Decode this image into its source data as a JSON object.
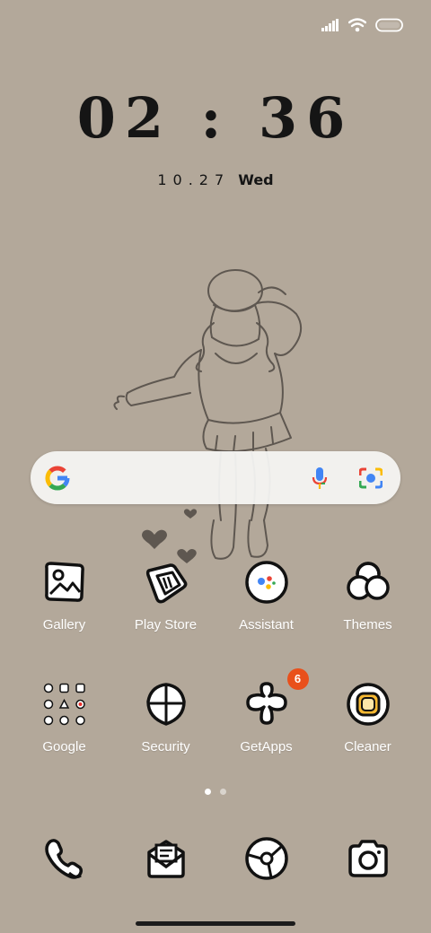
{
  "status_bar": {
    "icons": [
      "signal-icon",
      "wifi-icon",
      "battery-icon"
    ]
  },
  "lockscreen_clock": {
    "time": "02 : 36",
    "date_digits": "10.27",
    "weekday": "Wed"
  },
  "search_bar": {
    "icons": [
      "google-g-icon",
      "microphone-icon",
      "google-lens-icon"
    ]
  },
  "apps_row1": [
    {
      "label": "Gallery",
      "icon": "gallery-icon"
    },
    {
      "label": "Play Store",
      "icon": "play-store-icon"
    },
    {
      "label": "Assistant",
      "icon": "assistant-icon"
    },
    {
      "label": "Themes",
      "icon": "themes-icon"
    }
  ],
  "apps_row2": [
    {
      "label": "Google",
      "icon": "google-folder-icon"
    },
    {
      "label": "Security",
      "icon": "security-icon"
    },
    {
      "label": "GetApps",
      "icon": "getapps-icon",
      "badge": "6"
    },
    {
      "label": "Cleaner",
      "icon": "cleaner-icon"
    }
  ],
  "page_indicator": {
    "pages": 2,
    "current": 1
  },
  "dock": [
    {
      "icon": "phone-icon"
    },
    {
      "icon": "messages-icon"
    },
    {
      "icon": "browser-icon"
    },
    {
      "icon": "camera-icon"
    }
  ],
  "colors": {
    "background": "#b3a89a",
    "badge": "#e9501b",
    "icon_fill": "#ffffff",
    "icon_stroke": "#111111"
  }
}
